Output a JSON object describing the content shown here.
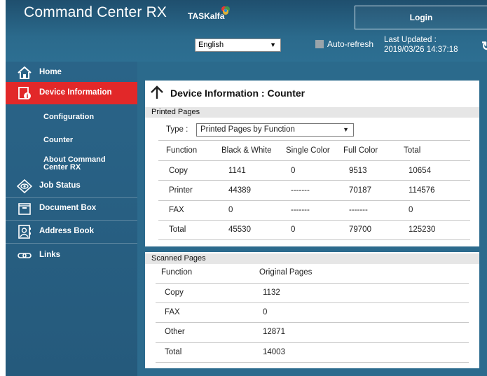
{
  "header": {
    "app_title": "Command Center RX",
    "product": "TASKalfa",
    "login_label": "Login",
    "language": "English",
    "auto_refresh_label": "Auto-refresh",
    "last_updated_label": "Last Updated :",
    "last_updated_value": "2019/03/26 14:37:18"
  },
  "sidebar": {
    "items": [
      {
        "label": "Home",
        "icon": "home-icon"
      },
      {
        "label": "Device Information",
        "icon": "device-info-icon",
        "active": true
      },
      {
        "label": "Job Status",
        "icon": "eye-icon"
      },
      {
        "label": "Document Box",
        "icon": "folder-icon"
      },
      {
        "label": "Address Book",
        "icon": "address-book-icon"
      },
      {
        "label": "Links",
        "icon": "link-icon"
      }
    ],
    "sub_items": [
      {
        "label": "Configuration"
      },
      {
        "label": "Counter"
      },
      {
        "label": "About Command Center RX"
      }
    ]
  },
  "main": {
    "title": "Device Information : Counter",
    "printed": {
      "heading": "Printed Pages",
      "type_label": "Type :",
      "type_value": "Printed Pages by Function",
      "columns": [
        "Function",
        "Black & White",
        "Single Color",
        "Full Color",
        "Total"
      ],
      "rows": [
        [
          "Copy",
          "1141",
          "0",
          "9513",
          "10654"
        ],
        [
          "Printer",
          "44389",
          "-------",
          "70187",
          "114576"
        ],
        [
          "FAX",
          "0",
          "-------",
          "-------",
          "0"
        ],
        [
          "Total",
          "45530",
          "0",
          "79700",
          "125230"
        ]
      ]
    },
    "scanned": {
      "heading": "Scanned Pages",
      "columns": [
        "Function",
        "Original Pages"
      ],
      "rows": [
        [
          "Copy",
          "1132"
        ],
        [
          "FAX",
          "0"
        ],
        [
          "Other",
          "12871"
        ],
        [
          "Total",
          "14003"
        ]
      ]
    }
  },
  "colors": {
    "header_bg": "#1f4f6e",
    "sidebar_bg": "#2a6488",
    "active_red": "#e22829"
  }
}
